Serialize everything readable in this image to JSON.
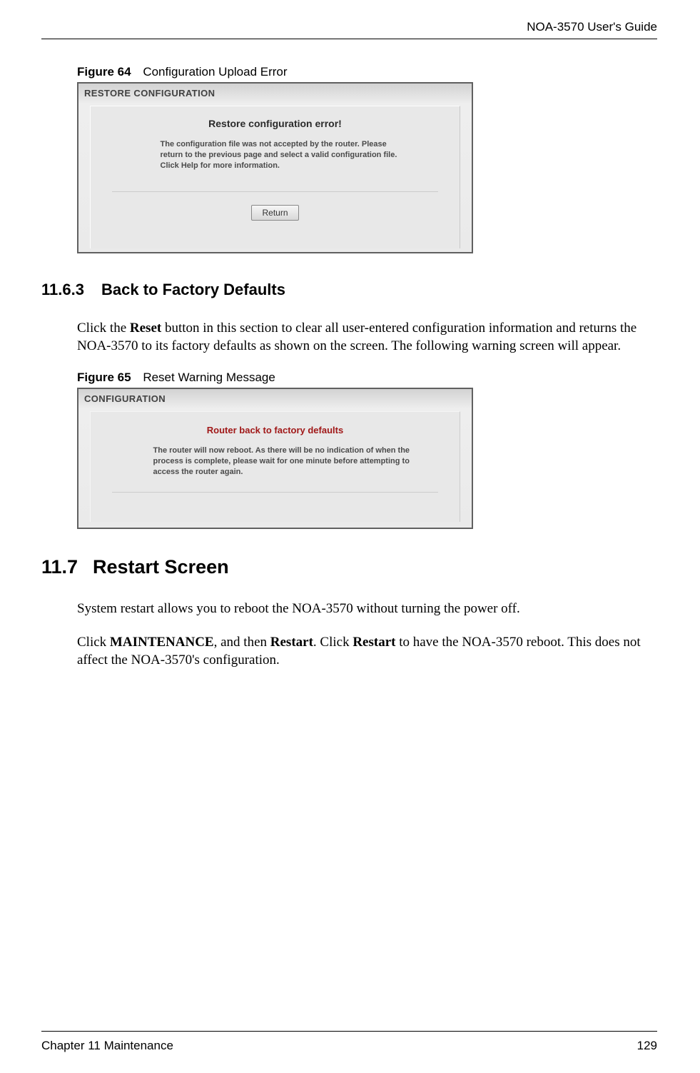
{
  "header": {
    "guide_title": "NOA-3570 User's Guide"
  },
  "figure64": {
    "label": "Figure 64",
    "title": "Configuration Upload Error",
    "screenshot": {
      "titlebar": "RESTORE CONFIGURATION",
      "error_title": "Restore configuration error!",
      "error_body": "The configuration file was not accepted by the router. Please return to the previous page and select a valid configuration file. Click Help for more information.",
      "button_label": "Return"
    }
  },
  "section_1163": {
    "number": "11.6.3",
    "title": "Back to Factory Defaults",
    "body_pre": "Click the ",
    "body_bold1": "Reset",
    "body_post": " button in this section to clear all user-entered configuration information and returns the NOA-3570 to its factory defaults as shown on the screen. The following warning screen will appear."
  },
  "figure65": {
    "label": "Figure 65",
    "title": "Reset Warning Message",
    "screenshot": {
      "titlebar": "CONFIGURATION",
      "red_title": "Router back to factory defaults",
      "body": "The router will now reboot.\nAs there will be no indication of when the process is complete, please wait for one minute before attempting to access the router again."
    }
  },
  "section_117": {
    "number": "11.7",
    "title": "Restart Screen",
    "para1": "System restart allows you to reboot the NOA-3570 without turning the power off.",
    "para2_pre": "Click ",
    "para2_b1": "MAINTENANCE",
    "para2_mid1": ", and then ",
    "para2_b2": "Restart",
    "para2_mid2": ". Click ",
    "para2_b3": "Restart",
    "para2_post": " to have the NOA-3570 reboot. This does not affect the NOA-3570's configuration."
  },
  "footer": {
    "chapter": "Chapter 11 Maintenance",
    "page": "129"
  }
}
